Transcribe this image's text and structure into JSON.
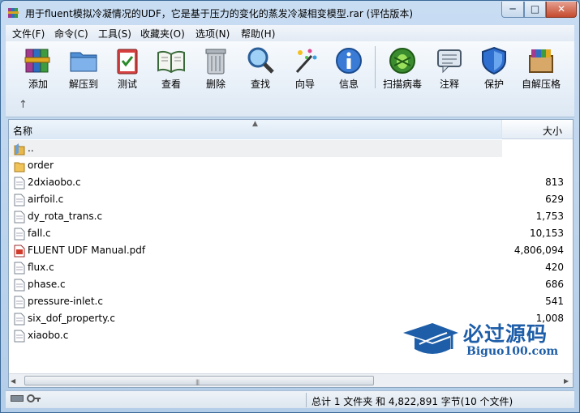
{
  "window": {
    "title": "用于fluent模拟冷凝情况的UDF，它是基于压力的变化的蒸发冷凝相变模型.rar (评估版本)",
    "min_label": "─",
    "max_label": "□",
    "close_label": "✕"
  },
  "menu": [
    {
      "label": "文件(F)"
    },
    {
      "label": "命令(C)"
    },
    {
      "label": "工具(S)"
    },
    {
      "label": "收藏夹(O)"
    },
    {
      "label": "选项(N)"
    },
    {
      "label": "帮助(H)"
    }
  ],
  "toolbar": [
    {
      "label": "添加",
      "icon": "books-add-icon"
    },
    {
      "label": "解压到",
      "icon": "folder-extract-icon"
    },
    {
      "label": "测试",
      "icon": "clipboard-test-icon"
    },
    {
      "label": "查看",
      "icon": "book-view-icon"
    },
    {
      "label": "删除",
      "icon": "trash-icon"
    },
    {
      "label": "查找",
      "icon": "magnifier-icon"
    },
    {
      "label": "向导",
      "icon": "wand-icon"
    },
    {
      "label": "信息",
      "icon": "info-icon"
    },
    {
      "label": "扫描病毒",
      "icon": "virus-scan-icon"
    },
    {
      "label": "注释",
      "icon": "comment-icon"
    },
    {
      "label": "保护",
      "icon": "shield-icon"
    },
    {
      "label": "自解压格",
      "icon": "sfx-box-icon"
    }
  ],
  "up_arrow": "↑",
  "columns": {
    "name": "名称",
    "size": "大小",
    "sort_indicator": "▲"
  },
  "files": [
    {
      "name": "..",
      "size": "",
      "type": "parent",
      "selected": true
    },
    {
      "name": "order",
      "size": "",
      "type": "folder"
    },
    {
      "name": "2dxiaobo.c",
      "size": "813",
      "type": "file"
    },
    {
      "name": "airfoil.c",
      "size": "629",
      "type": "file"
    },
    {
      "name": "dy_rota_trans.c",
      "size": "1,753",
      "type": "file"
    },
    {
      "name": "fall.c",
      "size": "10,153",
      "type": "file"
    },
    {
      "name": "FLUENT UDF Manual.pdf",
      "size": "4,806,094",
      "type": "pdf"
    },
    {
      "name": "flux.c",
      "size": "420",
      "type": "file"
    },
    {
      "name": "phase.c",
      "size": "686",
      "type": "file"
    },
    {
      "name": "pressure-inlet.c",
      "size": "541",
      "type": "file"
    },
    {
      "name": "six_dof_property.c",
      "size": "1,008",
      "type": "file"
    },
    {
      "name": "xiaobo.c",
      "size": "",
      "type": "file"
    }
  ],
  "scrollbar": {
    "left": "◀",
    "right": "▶",
    "grip": "|||"
  },
  "status": {
    "summary": "总计 1 文件夹 和 4,822,891 字节(10 个文件)"
  },
  "watermark": {
    "title": "必过源码",
    "url": "Biguo100.com"
  },
  "colors": {
    "accent": "#1e5ea8",
    "folder": "#e8b84a",
    "title_bar": "#c8dcf2"
  }
}
